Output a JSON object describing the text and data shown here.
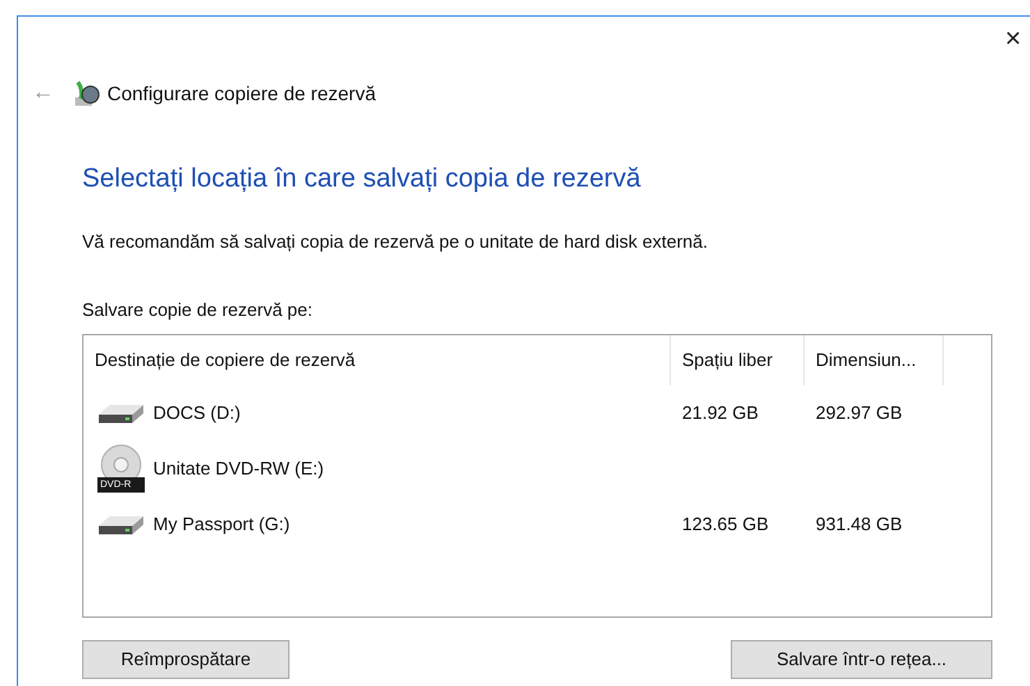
{
  "window": {
    "title": "Configurare copiere de rezervă",
    "close": "×",
    "back": "←"
  },
  "heading": "Selectați locația în care salvați copia de rezervă",
  "recommendation": "Vă recomandăm să salvați copia de rezervă pe o unitate de hard disk externă.",
  "list_label": "Salvare copie de rezervă pe:",
  "table": {
    "columns": [
      "Destinație de copiere de rezervă",
      "Spațiu liber",
      "Dimensiun..."
    ],
    "rows": [
      {
        "kind": "hdd",
        "name": "DOCS (D:)",
        "free": "21.92 GB",
        "size": "292.97 GB"
      },
      {
        "kind": "dvd",
        "name": "Unitate DVD-RW (E:)",
        "badge": "DVD-R"
      },
      {
        "kind": "hdd",
        "name": "My Passport (G:)",
        "free": "123.65 GB",
        "size": "931.48 GB"
      }
    ]
  },
  "buttons": [
    "Reîmprospătare",
    "Salvare într-o rețea..."
  ]
}
